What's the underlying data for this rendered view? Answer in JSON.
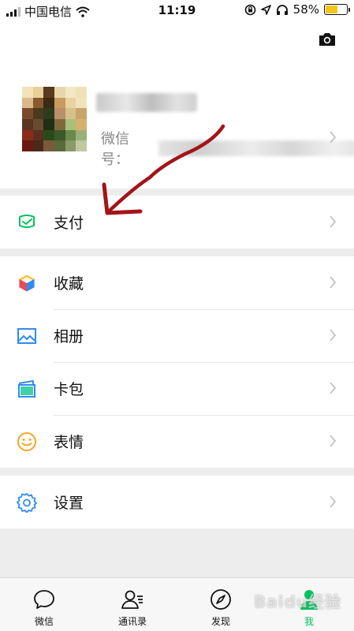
{
  "status_bar": {
    "carrier": "中国电信",
    "time": "11:19",
    "battery_percent": "58%",
    "battery_level": 0.58
  },
  "profile": {
    "wechat_id_label": "微信号："
  },
  "menu": {
    "pay": "支付",
    "favorites": "收藏",
    "album": "相册",
    "cards": "卡包",
    "stickers": "表情",
    "settings": "设置"
  },
  "tabs": [
    {
      "label": "微信",
      "icon": "chat-bubble-icon",
      "active": false
    },
    {
      "label": "通讯录",
      "icon": "contacts-icon",
      "active": false
    },
    {
      "label": "发现",
      "icon": "compass-icon",
      "active": false
    },
    {
      "label": "我",
      "icon": "person-icon",
      "active": true
    }
  ],
  "colors": {
    "accent_green": "#07c160",
    "annotation_arrow": "#a31418",
    "battery_fill": "#f5c518"
  }
}
